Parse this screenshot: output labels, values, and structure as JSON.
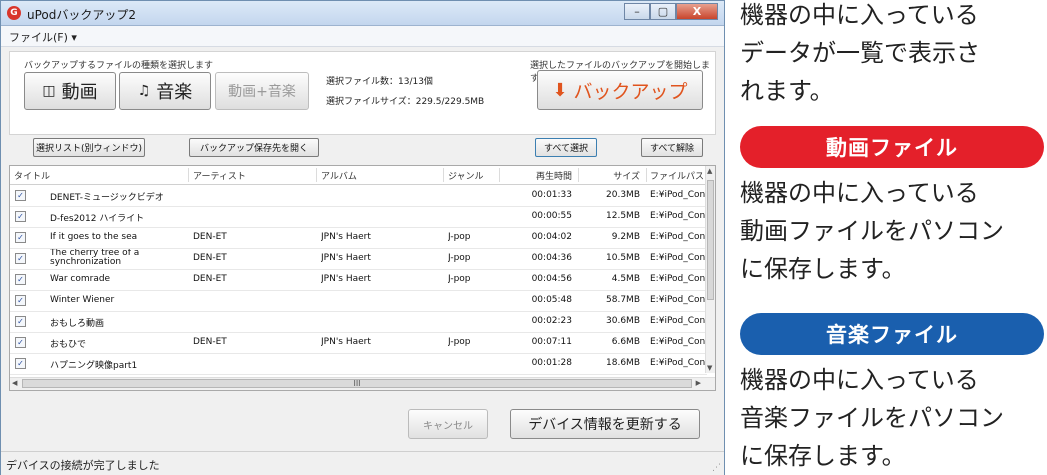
{
  "window": {
    "title": "uPodバックアップ2",
    "app_icon_glyph": "G",
    "buttons": {
      "minimize": "–",
      "maximize": "▢",
      "close": "X"
    }
  },
  "menu": {
    "file_label": "ファイル(F) ▾"
  },
  "top": {
    "select_hint": "バックアップするファイルの種類を選択します",
    "start_hint": "選択したファイルのバックアップを開始します",
    "video_label": "動画",
    "video_icon": "film-icon",
    "music_label": "音楽",
    "music_icon": "music-note-icon",
    "both_label": "動画+音楽",
    "selected_count": "選択ファイル数：13/13個",
    "selected_size": "選択ファイルサイズ：229.5/229.5MB",
    "backup_label": "バックアップ",
    "backup_icon": "down-arrow-icon"
  },
  "actions": {
    "list_window": "選択リスト(別ウィンドウ)",
    "open_dest": "バックアップ保存先を開く",
    "select_all": "すべて選択",
    "deselect_all": "すべて解除"
  },
  "table": {
    "headers": [
      "タイトル",
      "アーティスト",
      "アルバム",
      "ジャンル",
      "再生時間",
      "サイズ",
      "ファイルパス"
    ],
    "rows": [
      {
        "title": "DENET-ミュージックビデオ",
        "artist": "",
        "album": "",
        "genre": "",
        "time": "00:01:33",
        "size": "20.3MB",
        "path": "E:¥iPod_Con.."
      },
      {
        "title": "D-fes2012 ハイライト",
        "artist": "",
        "album": "",
        "genre": "",
        "time": "00:00:55",
        "size": "12.5MB",
        "path": "E:¥iPod_Con.."
      },
      {
        "title": "If it goes to the sea",
        "artist": "DEN-ET",
        "album": "JPN's Haert",
        "genre": "J-pop",
        "time": "00:04:02",
        "size": "9.2MB",
        "path": "E:¥iPod_Con.."
      },
      {
        "title": "The cherry tree of a synchronization",
        "artist": "DEN-ET",
        "album": "JPN's Haert",
        "genre": "J-pop",
        "time": "00:04:36",
        "size": "10.5MB",
        "path": "E:¥iPod_Con.."
      },
      {
        "title": "War comrade",
        "artist": "DEN-ET",
        "album": "JPN's Haert",
        "genre": "J-pop",
        "time": "00:04:56",
        "size": "4.5MB",
        "path": "E:¥iPod_Con.."
      },
      {
        "title": "Winter Wiener",
        "artist": "",
        "album": "",
        "genre": "",
        "time": "00:05:48",
        "size": "58.7MB",
        "path": "E:¥iPod_Con.."
      },
      {
        "title": "おもしろ動画",
        "artist": "",
        "album": "",
        "genre": "",
        "time": "00:02:23",
        "size": "30.6MB",
        "path": "E:¥iPod_Con.."
      },
      {
        "title": "おもひで",
        "artist": "DEN-ET",
        "album": "JPN's Haert",
        "genre": "J-pop",
        "time": "00:07:11",
        "size": "6.6MB",
        "path": "E:¥iPod_Con.."
      },
      {
        "title": "ハプニング映像part1",
        "artist": "",
        "album": "",
        "genre": "",
        "time": "00:01:28",
        "size": "18.6MB",
        "path": "E:¥iPod_Con.."
      }
    ],
    "scroll_thumb_glyph": "III"
  },
  "footer": {
    "cancel": "キャンセル",
    "refresh": "デバイス情報を更新する"
  },
  "status": {
    "text": "デバイスの接続が完了しました"
  },
  "side": {
    "intro": [
      "機器の中に入っている",
      "データが一覧で表示さ",
      "れます。"
    ],
    "video_heading": "動画ファイル",
    "video_desc": [
      "機器の中に入っている",
      "動画ファイルをパソコン",
      "に保存します。"
    ],
    "music_heading": "音楽ファイル",
    "music_desc": [
      "機器の中に入っている",
      "音楽ファイルをパソコン",
      "に保存します。"
    ]
  },
  "colors": {
    "video_pill": "#e4202a",
    "music_pill": "#1a5fae",
    "backup_accent": "#e0541e",
    "checkbox_check": "#2b4fa0"
  }
}
